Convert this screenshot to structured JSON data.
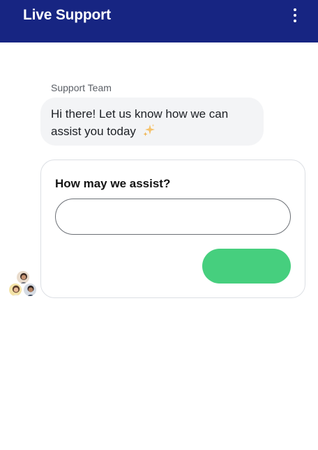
{
  "header": {
    "title": "Live Support",
    "menu_icon": "more-vertical-icon",
    "background_color": "#172582"
  },
  "chat": {
    "sender_name": "Support Team",
    "message": "Hi there! Let us know how we can assist you today",
    "message_emoji_icon": "sparkles-icon"
  },
  "form": {
    "title": "How may we assist?",
    "input_value": "",
    "input_placeholder": "",
    "submit_label": "",
    "submit_color": "#46cf7e"
  },
  "team_avatars": [
    {
      "icon": "agent-avatar"
    },
    {
      "icon": "agent-avatar"
    },
    {
      "icon": "agent-avatar"
    }
  ]
}
